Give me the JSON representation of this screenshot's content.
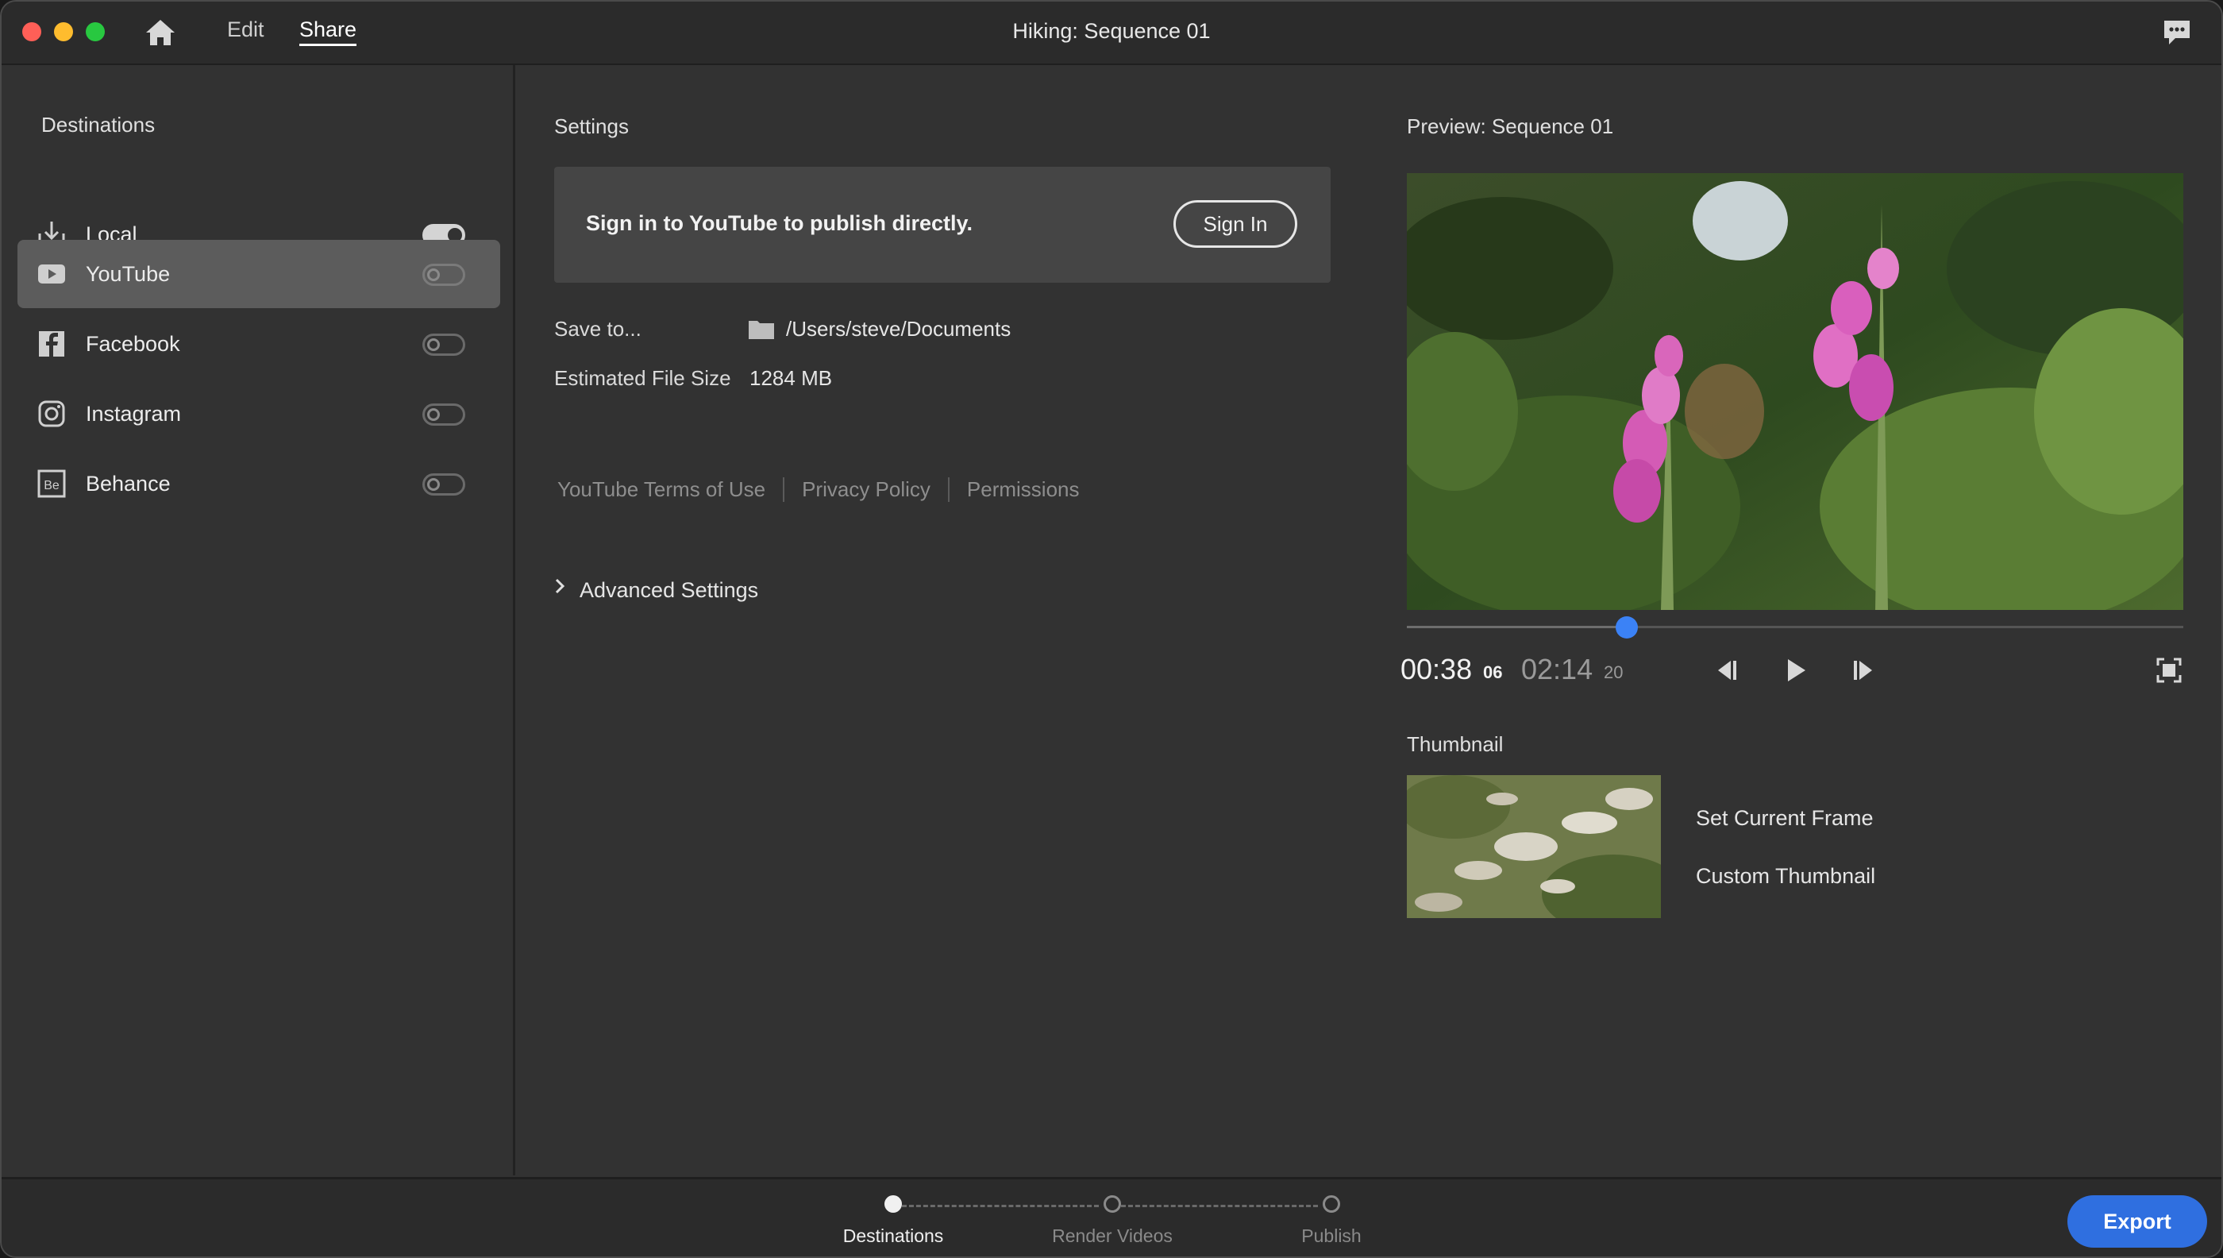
{
  "titlebar": {
    "tabs": [
      {
        "label": "Edit"
      },
      {
        "label": "Share"
      }
    ],
    "window_title": "Hiking: Sequence 01"
  },
  "sidebar": {
    "title": "Destinations",
    "items": [
      {
        "label": "Local",
        "icon": "download-icon",
        "enabled": true,
        "selected": false
      },
      {
        "label": "YouTube",
        "icon": "youtube-icon",
        "enabled": false,
        "selected": true
      },
      {
        "label": "Facebook",
        "icon": "facebook-icon",
        "enabled": false,
        "selected": false
      },
      {
        "label": "Instagram",
        "icon": "instagram-icon",
        "enabled": false,
        "selected": false
      },
      {
        "label": "Behance",
        "icon": "behance-icon",
        "enabled": false,
        "selected": false
      }
    ]
  },
  "settings": {
    "title": "Settings",
    "signin_text": "Sign in to YouTube to publish directly.",
    "signin_button": "Sign In",
    "save_to_label": "Save to...",
    "save_to_path": "/Users/steve/Documents",
    "file_size_label": "Estimated File Size",
    "file_size_value": "1284 MB",
    "links": [
      "YouTube Terms of Use",
      "Privacy Policy",
      "Permissions"
    ],
    "advanced_label": "Advanced Settings"
  },
  "preview": {
    "title": "Preview: Sequence 01",
    "current_time": "00:38",
    "current_frames": "06",
    "total_time": "02:14",
    "total_frames": "20",
    "playhead_fraction": 0.283,
    "thumbnail_title": "Thumbnail",
    "set_current_frame": "Set Current Frame",
    "custom_thumbnail": "Custom Thumbnail"
  },
  "footer": {
    "steps": [
      {
        "label": "Destinations",
        "active": true
      },
      {
        "label": "Render Videos",
        "active": false
      },
      {
        "label": "Publish",
        "active": false
      }
    ],
    "export_label": "Export"
  },
  "colors": {
    "accent": "#2f6fe0",
    "playhead": "#3b82f6",
    "background": "#323232"
  }
}
